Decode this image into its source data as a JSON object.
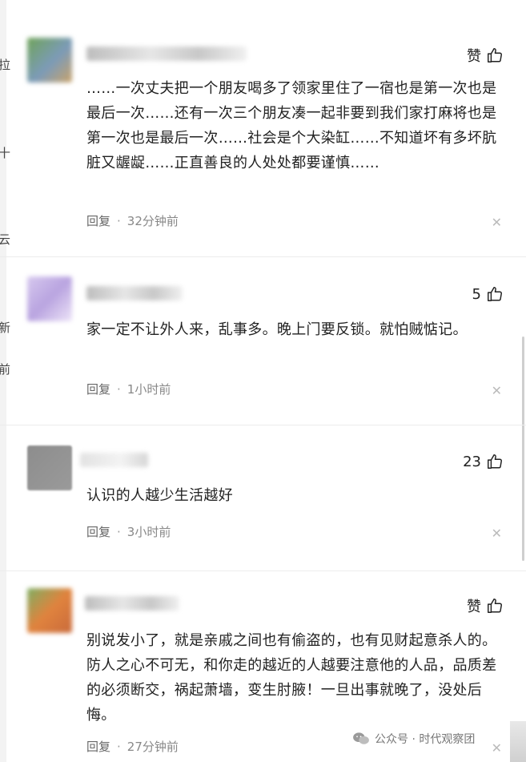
{
  "left_fragments": [
    "拉",
    "十",
    "云",
    "新",
    "前"
  ],
  "comments": [
    {
      "like_label": "赞",
      "text": "……一次丈夫把一个朋友喝多了领家里住了一宿也是第一次也是最后一次……还有一次三个朋友凑一起非要到我们家打麻将也是第一次也是最后一次……社会是个大染缸……不知道坏有多坏肮脏又龌龊……正直善良的人处处都要谨慎……",
      "reply_label": "回复",
      "separator": "·",
      "time": "32分钟前",
      "close": "✕"
    },
    {
      "like_label": "5",
      "text": "家一定不让外人来，乱事多。晚上门要反锁。就怕贼惦记。",
      "reply_label": "回复",
      "separator": "·",
      "time": "1小时前",
      "close": "✕"
    },
    {
      "like_label": "23",
      "text": "认识的人越少生活越好",
      "reply_label": "回复",
      "separator": "·",
      "time": "3小时前",
      "close": "✕"
    },
    {
      "like_label": "赞",
      "text": "别说发小了，就是亲戚之间也有偷盗的，也有见财起意杀人的。防人之心不可无，和你走的越近的人越要注意他的人品，品质差的必须断交，祸起萧墙，变生肘腋！一旦出事就晚了，没处后悔。",
      "reply_label": "回复",
      "separator": "·",
      "time": "27分钟前",
      "close": "✕"
    }
  ],
  "watermark": "公众号 · 时代观察团"
}
